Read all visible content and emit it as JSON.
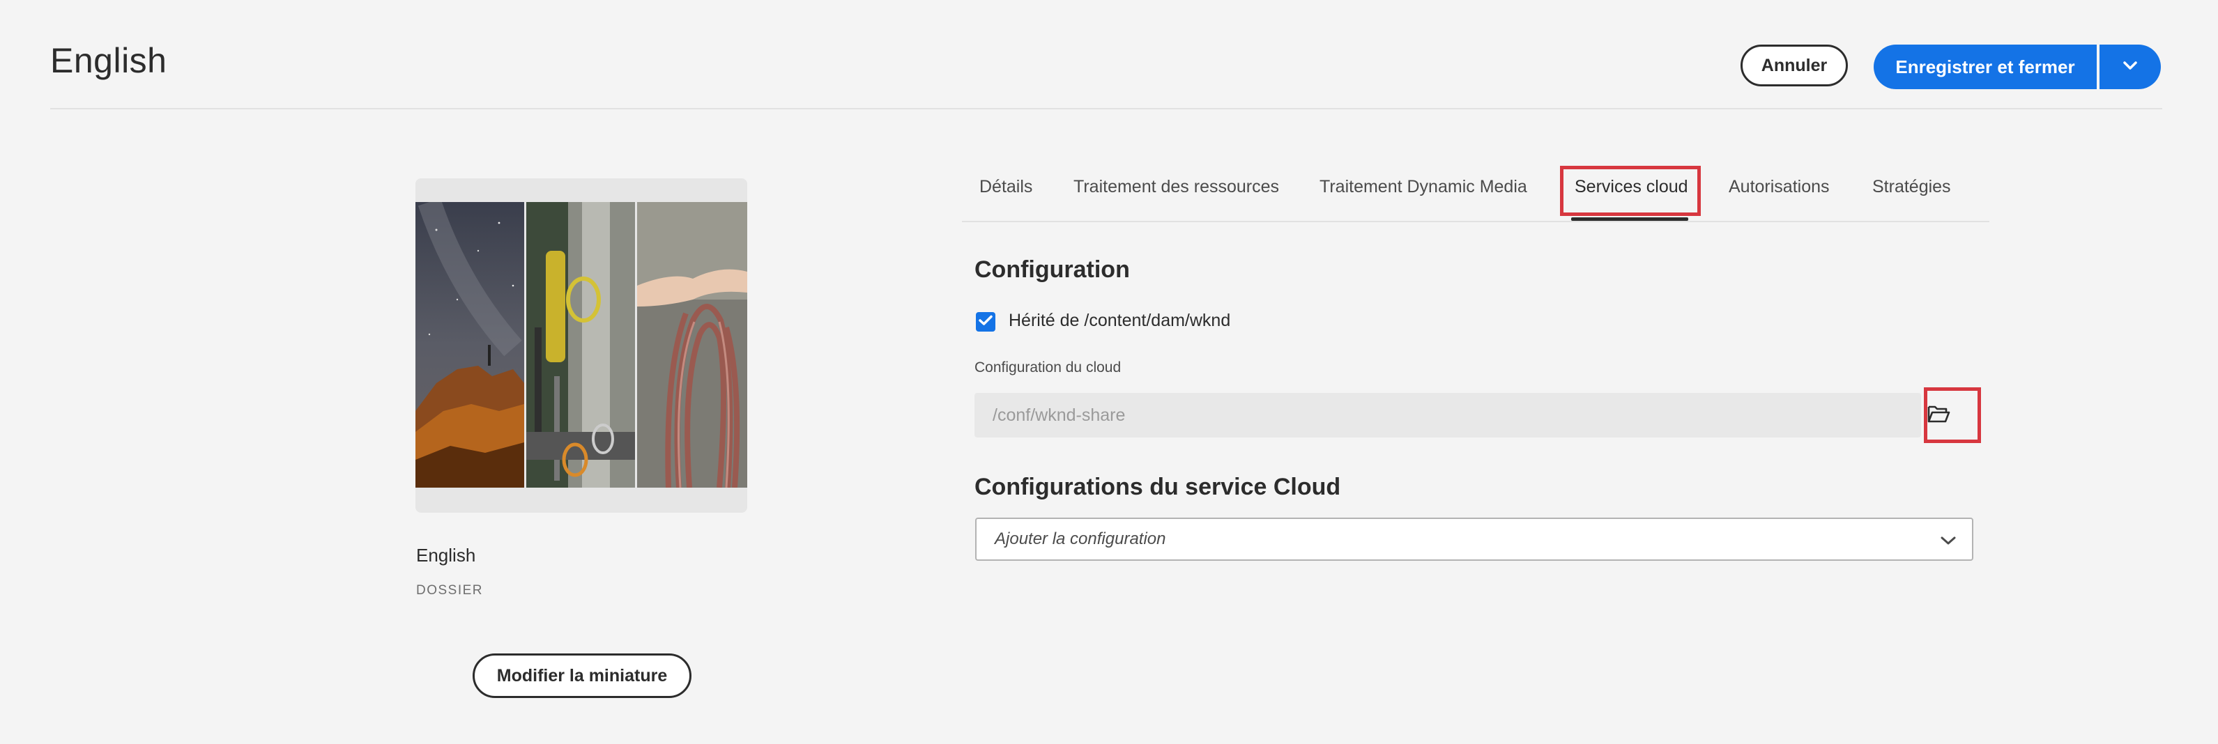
{
  "header": {
    "title": "English",
    "cancel_label": "Annuler",
    "save_label": "Enregistrer et fermer"
  },
  "left_panel": {
    "folder_name": "English",
    "folder_type": "DOSSIER",
    "edit_thumbnail_label": "Modifier la miniature"
  },
  "tabs": [
    {
      "label": "Détails"
    },
    {
      "label": "Traitement des ressources"
    },
    {
      "label": "Traitement Dynamic Media"
    },
    {
      "label": "Services cloud",
      "active": true
    },
    {
      "label": "Autorisations"
    },
    {
      "label": "Stratégies"
    }
  ],
  "configuration": {
    "heading": "Configuration",
    "inherit_checked": true,
    "inherit_label": "Hérité de /content/dam/wknd",
    "cloud_config_label": "Configuration du cloud",
    "cloud_config_value": "/conf/wknd-share"
  },
  "cloud_services": {
    "heading": "Configurations du service Cloud",
    "add_placeholder": "Ajouter la configuration"
  },
  "colors": {
    "accent": "#1473e6",
    "highlight": "#d7373f",
    "background": "#f4f4f4"
  },
  "icons": [
    "chevron-down-icon",
    "checkmark-icon",
    "folder-open-icon"
  ]
}
